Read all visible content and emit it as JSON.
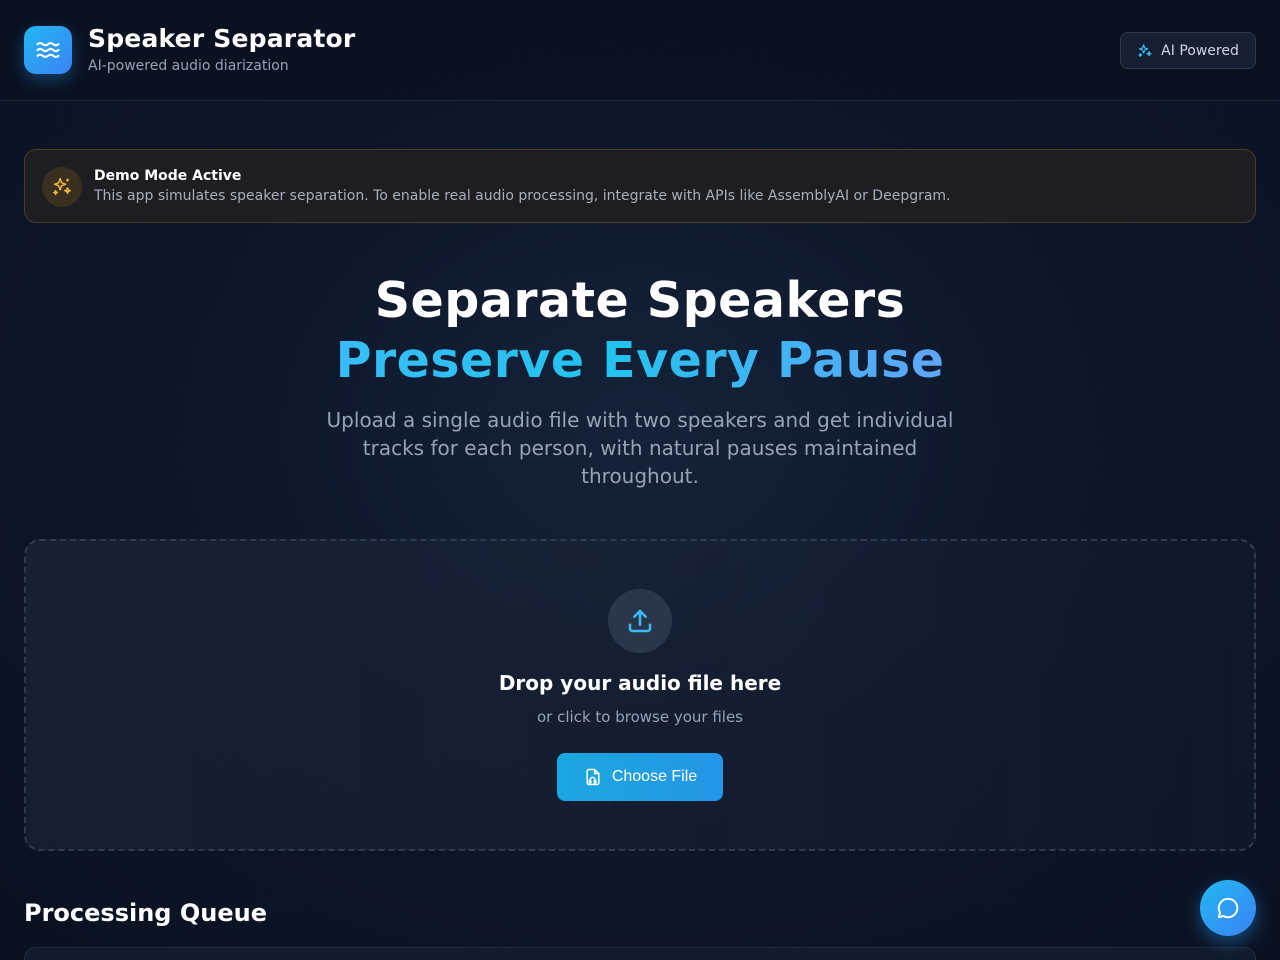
{
  "header": {
    "title": "Speaker Separator",
    "subtitle": "AI-powered audio diarization",
    "logo_icon": "waves-icon",
    "badge_icon": "sparkles-icon",
    "badge_label": "AI Powered"
  },
  "demo_banner": {
    "icon": "sparkles-icon",
    "title": "Demo Mode Active",
    "text": "This app simulates speaker separation. To enable real audio processing, integrate with APIs like AssemblyAI or Deepgram."
  },
  "hero": {
    "title": "Separate Speakers",
    "accent": "Preserve Every Pause",
    "description": "Upload a single audio file with two speakers and get individual tracks for each person, with natural pauses maintained throughout."
  },
  "dropzone": {
    "icon": "upload-icon",
    "title": "Drop your audio file here",
    "subtitle": "or click to browse your files",
    "button_icon": "file-audio-icon",
    "button_label": "Choose File"
  },
  "queue": {
    "title": "Processing Queue"
  },
  "chat": {
    "icon": "chat-bubble-icon"
  },
  "colors": {
    "accent": "#38bdf8",
    "brand_gradient_start": "#22b8f0",
    "brand_gradient_end": "#3b82f6",
    "warning": "#f5b83d",
    "background": "#0d1729"
  }
}
